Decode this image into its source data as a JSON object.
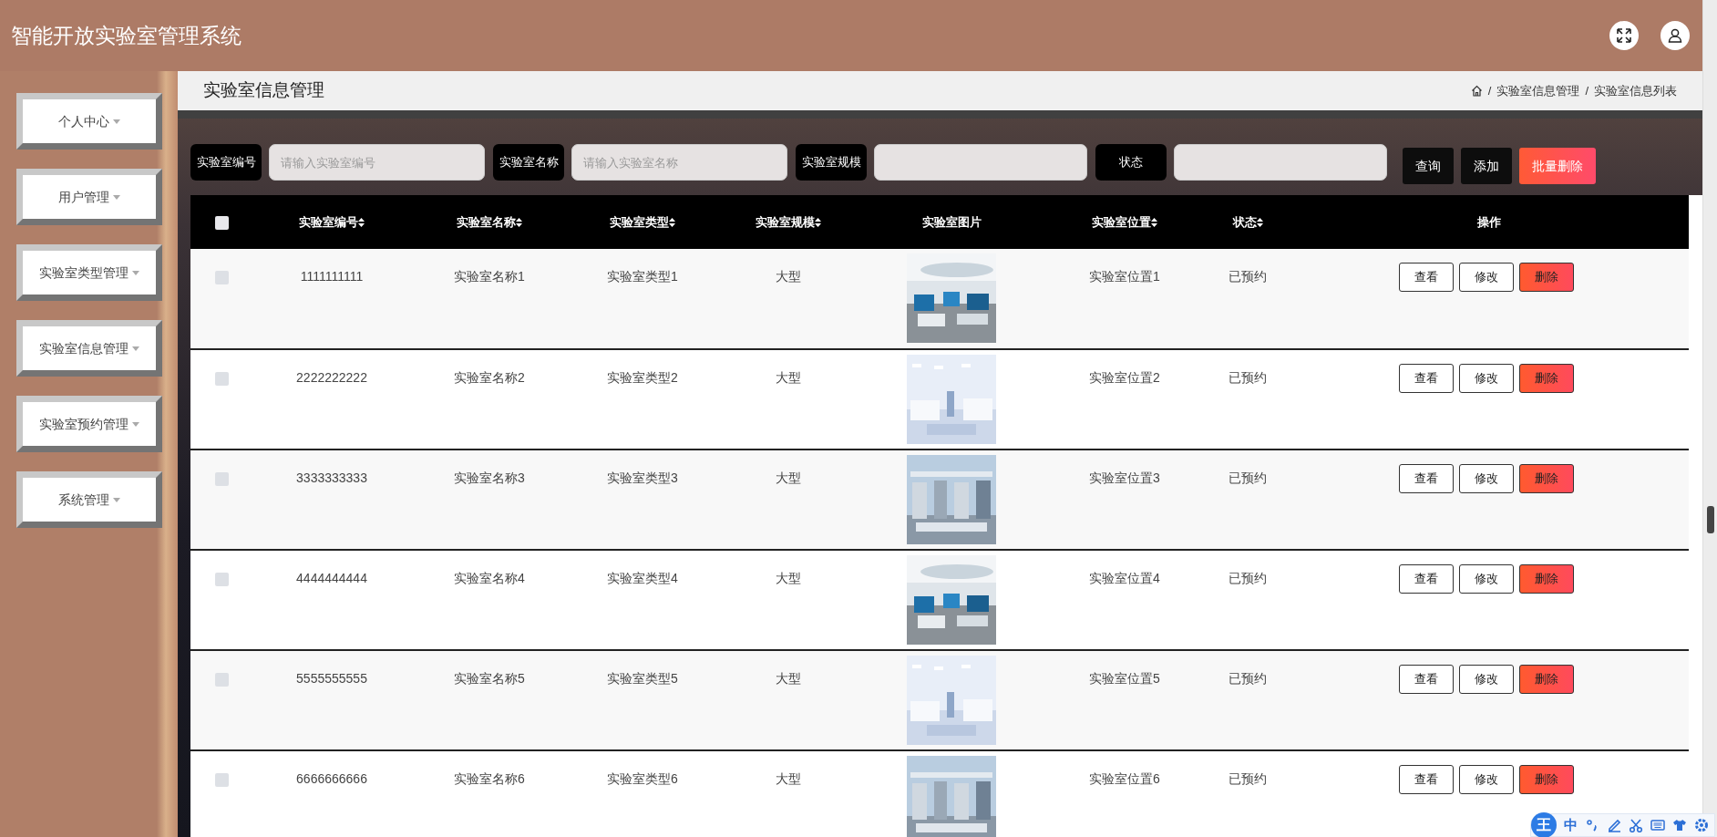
{
  "app_title": "智能开放实验室管理系统",
  "sidebar": {
    "items": [
      {
        "label": "个人中心"
      },
      {
        "label": "用户管理"
      },
      {
        "label": "实验室类型管理"
      },
      {
        "label": "实验室信息管理"
      },
      {
        "label": "实验室预约管理"
      },
      {
        "label": "系统管理"
      }
    ]
  },
  "page_title": "实验室信息管理",
  "breadcrumb": {
    "separator": "/",
    "items": [
      "实验室信息管理",
      "实验室信息列表"
    ]
  },
  "filters": [
    {
      "kind": "text",
      "label": "实验室编号",
      "placeholder": "请输入实验室编号"
    },
    {
      "kind": "text",
      "label": "实验室名称",
      "placeholder": "请输入实验室名称"
    },
    {
      "kind": "select",
      "label": "实验室规模"
    },
    {
      "kind": "select",
      "label": "状态"
    }
  ],
  "actions": [
    {
      "label": "查询",
      "kind": "dark"
    },
    {
      "label": "添加",
      "kind": "dark"
    },
    {
      "label": "批量删除",
      "kind": "danger"
    }
  ],
  "table": {
    "select_all": {
      "checked": false
    },
    "columns": [
      {
        "label": "实验室编号",
        "sortable": true
      },
      {
        "label": "实验室名称",
        "sortable": true
      },
      {
        "label": "实验室类型",
        "sortable": true
      },
      {
        "label": "实验室规模",
        "sortable": true
      },
      {
        "label": "实验室图片",
        "sortable": false
      },
      {
        "label": "实验室位置",
        "sortable": true
      },
      {
        "label": "状态",
        "sortable": true
      },
      {
        "label": "操作",
        "sortable": false
      }
    ],
    "rows": [
      {
        "checked": false,
        "number": "1111111111",
        "name": "实验室名称1",
        "type": "实验室类型1",
        "scale": "大型",
        "location": "实验室位置1",
        "status": "已预约",
        "actions": [
          {
            "label": "查看",
            "kind": "outline"
          },
          {
            "label": "修改",
            "kind": "outline"
          },
          {
            "label": "删除",
            "kind": "danger"
          }
        ]
      },
      {
        "checked": false,
        "number": "2222222222",
        "name": "实验室名称2",
        "type": "实验室类型2",
        "scale": "大型",
        "location": "实验室位置2",
        "status": "已预约",
        "actions": [
          {
            "label": "查看",
            "kind": "outline"
          },
          {
            "label": "修改",
            "kind": "outline"
          },
          {
            "label": "删除",
            "kind": "danger"
          }
        ]
      },
      {
        "checked": false,
        "number": "3333333333",
        "name": "实验室名称3",
        "type": "实验室类型3",
        "scale": "大型",
        "location": "实验室位置3",
        "status": "已预约",
        "actions": [
          {
            "label": "查看",
            "kind": "outline"
          },
          {
            "label": "修改",
            "kind": "outline"
          },
          {
            "label": "删除",
            "kind": "danger"
          }
        ]
      },
      {
        "checked": false,
        "number": "4444444444",
        "name": "实验室名称4",
        "type": "实验室类型4",
        "scale": "大型",
        "location": "实验室位置4",
        "status": "已预约",
        "actions": [
          {
            "label": "查看",
            "kind": "outline"
          },
          {
            "label": "修改",
            "kind": "outline"
          },
          {
            "label": "删除",
            "kind": "danger"
          }
        ]
      },
      {
        "checked": false,
        "number": "5555555555",
        "name": "实验室名称5",
        "type": "实验室类型5",
        "scale": "大型",
        "location": "实验室位置5",
        "status": "已预约",
        "actions": [
          {
            "label": "查看",
            "kind": "outline"
          },
          {
            "label": "修改",
            "kind": "outline"
          },
          {
            "label": "删除",
            "kind": "danger"
          }
        ]
      },
      {
        "checked": false,
        "number": "6666666666",
        "name": "实验室名称6",
        "type": "实验室类型6",
        "scale": "大型",
        "location": "实验室位置6",
        "status": "已预约",
        "actions": [
          {
            "label": "查看",
            "kind": "outline"
          },
          {
            "label": "修改",
            "kind": "outline"
          },
          {
            "label": "删除",
            "kind": "danger"
          }
        ]
      }
    ]
  },
  "ime_toolbar": {
    "logo": "王",
    "mode": "中"
  }
}
